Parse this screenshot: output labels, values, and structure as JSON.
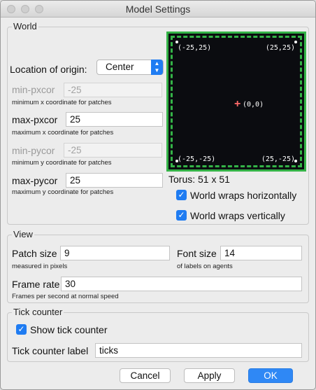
{
  "window": {
    "title": "Model Settings"
  },
  "world": {
    "legend": "World",
    "origin_label": "Location of origin:",
    "origin_value": "Center",
    "min_pxcor": {
      "label": "min-pxcor",
      "value": "-25",
      "hint": "minimum x coordinate for patches"
    },
    "max_pxcor": {
      "label": "max-pxcor",
      "value": "25",
      "hint": "maximum x coordinate for patches"
    },
    "min_pycor": {
      "label": "min-pycor",
      "value": "-25",
      "hint": "minimum y coordinate for patches"
    },
    "max_pycor": {
      "label": "max-pycor",
      "value": "25",
      "hint": "maximum y coordinate for patches"
    },
    "preview": {
      "top_left": "(-25,25)",
      "top_right": "(25,25)",
      "bottom_left": "(-25,-25)",
      "bottom_right": "(25,-25)",
      "center": "(0,0)",
      "center_marker": "+"
    },
    "torus": "Torus: 51 x 51",
    "wrap_horizontal": {
      "label": "World wraps horizontally",
      "checked": true
    },
    "wrap_vertical": {
      "label": "World wraps vertically",
      "checked": true
    }
  },
  "view": {
    "legend": "View",
    "patch_size": {
      "label": "Patch size",
      "value": "9",
      "hint": "measured in pixels"
    },
    "font_size": {
      "label": "Font size",
      "value": "14",
      "hint": "of labels on agents"
    },
    "frame_rate": {
      "label": "Frame rate",
      "value": "30",
      "hint": "Frames per second at normal speed"
    }
  },
  "tick_counter": {
    "legend": "Tick counter",
    "show": {
      "label": "Show tick counter",
      "checked": true
    },
    "label_field": {
      "label": "Tick counter label",
      "value": "ticks"
    }
  },
  "buttons": {
    "cancel": "Cancel",
    "apply": "Apply",
    "ok": "OK"
  },
  "icons": {
    "checkbox": "✓",
    "dropdown_up": "▲",
    "dropdown_down": "▼"
  },
  "colors": {
    "accent": "#1f7cf2",
    "preview_border": "#34b347",
    "preview_bg": "#0b0c10",
    "origin_marker": "#ff6a6a"
  }
}
